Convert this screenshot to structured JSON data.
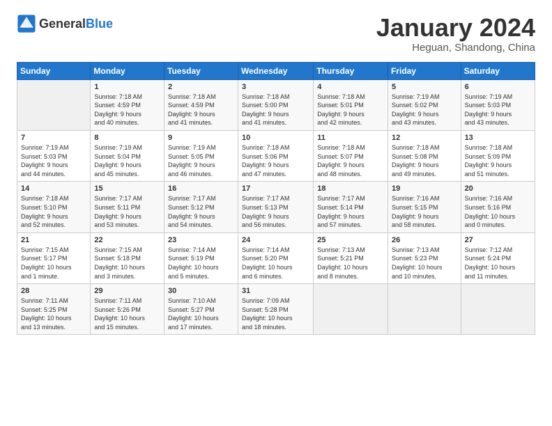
{
  "header": {
    "logo_general": "General",
    "logo_blue": "Blue",
    "title": "January 2024",
    "location": "Heguan, Shandong, China"
  },
  "days_of_week": [
    "Sunday",
    "Monday",
    "Tuesday",
    "Wednesday",
    "Thursday",
    "Friday",
    "Saturday"
  ],
  "weeks": [
    [
      {
        "num": "",
        "info": ""
      },
      {
        "num": "1",
        "info": "Sunrise: 7:18 AM\nSunset: 4:59 PM\nDaylight: 9 hours\nand 40 minutes."
      },
      {
        "num": "2",
        "info": "Sunrise: 7:18 AM\nSunset: 4:59 PM\nDaylight: 9 hours\nand 41 minutes."
      },
      {
        "num": "3",
        "info": "Sunrise: 7:18 AM\nSunset: 5:00 PM\nDaylight: 9 hours\nand 41 minutes."
      },
      {
        "num": "4",
        "info": "Sunrise: 7:18 AM\nSunset: 5:01 PM\nDaylight: 9 hours\nand 42 minutes."
      },
      {
        "num": "5",
        "info": "Sunrise: 7:19 AM\nSunset: 5:02 PM\nDaylight: 9 hours\nand 43 minutes."
      },
      {
        "num": "6",
        "info": "Sunrise: 7:19 AM\nSunset: 5:03 PM\nDaylight: 9 hours\nand 43 minutes."
      }
    ],
    [
      {
        "num": "7",
        "info": "Sunrise: 7:19 AM\nSunset: 5:03 PM\nDaylight: 9 hours\nand 44 minutes."
      },
      {
        "num": "8",
        "info": "Sunrise: 7:19 AM\nSunset: 5:04 PM\nDaylight: 9 hours\nand 45 minutes."
      },
      {
        "num": "9",
        "info": "Sunrise: 7:19 AM\nSunset: 5:05 PM\nDaylight: 9 hours\nand 46 minutes."
      },
      {
        "num": "10",
        "info": "Sunrise: 7:18 AM\nSunset: 5:06 PM\nDaylight: 9 hours\nand 47 minutes."
      },
      {
        "num": "11",
        "info": "Sunrise: 7:18 AM\nSunset: 5:07 PM\nDaylight: 9 hours\nand 48 minutes."
      },
      {
        "num": "12",
        "info": "Sunrise: 7:18 AM\nSunset: 5:08 PM\nDaylight: 9 hours\nand 49 minutes."
      },
      {
        "num": "13",
        "info": "Sunrise: 7:18 AM\nSunset: 5:09 PM\nDaylight: 9 hours\nand 51 minutes."
      }
    ],
    [
      {
        "num": "14",
        "info": "Sunrise: 7:18 AM\nSunset: 5:10 PM\nDaylight: 9 hours\nand 52 minutes."
      },
      {
        "num": "15",
        "info": "Sunrise: 7:17 AM\nSunset: 5:11 PM\nDaylight: 9 hours\nand 53 minutes."
      },
      {
        "num": "16",
        "info": "Sunrise: 7:17 AM\nSunset: 5:12 PM\nDaylight: 9 hours\nand 54 minutes."
      },
      {
        "num": "17",
        "info": "Sunrise: 7:17 AM\nSunset: 5:13 PM\nDaylight: 9 hours\nand 56 minutes."
      },
      {
        "num": "18",
        "info": "Sunrise: 7:17 AM\nSunset: 5:14 PM\nDaylight: 9 hours\nand 57 minutes."
      },
      {
        "num": "19",
        "info": "Sunrise: 7:16 AM\nSunset: 5:15 PM\nDaylight: 9 hours\nand 58 minutes."
      },
      {
        "num": "20",
        "info": "Sunrise: 7:16 AM\nSunset: 5:16 PM\nDaylight: 10 hours\nand 0 minutes."
      }
    ],
    [
      {
        "num": "21",
        "info": "Sunrise: 7:15 AM\nSunset: 5:17 PM\nDaylight: 10 hours\nand 1 minute."
      },
      {
        "num": "22",
        "info": "Sunrise: 7:15 AM\nSunset: 5:18 PM\nDaylight: 10 hours\nand 3 minutes."
      },
      {
        "num": "23",
        "info": "Sunrise: 7:14 AM\nSunset: 5:19 PM\nDaylight: 10 hours\nand 5 minutes."
      },
      {
        "num": "24",
        "info": "Sunrise: 7:14 AM\nSunset: 5:20 PM\nDaylight: 10 hours\nand 6 minutes."
      },
      {
        "num": "25",
        "info": "Sunrise: 7:13 AM\nSunset: 5:21 PM\nDaylight: 10 hours\nand 8 minutes."
      },
      {
        "num": "26",
        "info": "Sunrise: 7:13 AM\nSunset: 5:23 PM\nDaylight: 10 hours\nand 10 minutes."
      },
      {
        "num": "27",
        "info": "Sunrise: 7:12 AM\nSunset: 5:24 PM\nDaylight: 10 hours\nand 11 minutes."
      }
    ],
    [
      {
        "num": "28",
        "info": "Sunrise: 7:11 AM\nSunset: 5:25 PM\nDaylight: 10 hours\nand 13 minutes."
      },
      {
        "num": "29",
        "info": "Sunrise: 7:11 AM\nSunset: 5:26 PM\nDaylight: 10 hours\nand 15 minutes."
      },
      {
        "num": "30",
        "info": "Sunrise: 7:10 AM\nSunset: 5:27 PM\nDaylight: 10 hours\nand 17 minutes."
      },
      {
        "num": "31",
        "info": "Sunrise: 7:09 AM\nSunset: 5:28 PM\nDaylight: 10 hours\nand 18 minutes."
      },
      {
        "num": "",
        "info": ""
      },
      {
        "num": "",
        "info": ""
      },
      {
        "num": "",
        "info": ""
      }
    ]
  ]
}
